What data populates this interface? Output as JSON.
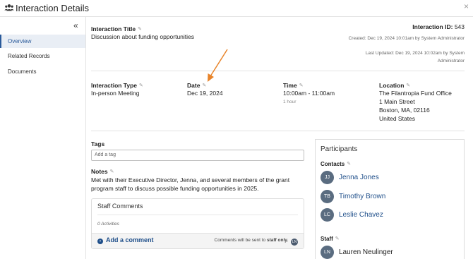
{
  "window": {
    "title": "Interaction Details",
    "close_label": "×"
  },
  "sidebar": {
    "collapse_label": "«",
    "items": [
      {
        "label": "Overview",
        "active": true
      },
      {
        "label": "Related Records",
        "active": false
      },
      {
        "label": "Documents",
        "active": false
      }
    ]
  },
  "interaction": {
    "title_label": "Interaction Title",
    "title_value": "Discussion about funding opportunities",
    "id_label": "Interaction ID:",
    "id_value": "543",
    "created": "Created: Dec 19, 2024 10:01am by System Administrator",
    "updated": "Last Updated: Dec 19, 2024 10:02am by System Administrator",
    "type_label": "Interaction Type",
    "type_value": "In-person Meeting",
    "date_label": "Date",
    "date_value": "Dec 19, 2024",
    "time_label": "Time",
    "time_value": "10:00am - 11:00am",
    "duration": "1 hour",
    "location_label": "Location",
    "location_lines": [
      "The Filantropia Fund Office",
      "1 Main Street",
      "Boston, MA, 02116",
      "United States"
    ]
  },
  "tags": {
    "label": "Tags",
    "placeholder": "Add a tag"
  },
  "notes": {
    "label": "Notes",
    "text": "Met with their Executive Director, Jenna, and several members of the grant program staff to discuss possible funding opportunities in 2025."
  },
  "comments": {
    "title": "Staff Comments",
    "count": "0 Activities",
    "add_label": "Add a comment",
    "note_prefix": "Comments will be sent to ",
    "note_bold": "staff only.",
    "note_initials": "LN"
  },
  "participants": {
    "title": "Participants",
    "contacts_label": "Contacts",
    "contacts": [
      {
        "initials": "JJ",
        "name": "Jenna Jones"
      },
      {
        "initials": "TB",
        "name": "Timothy Brown"
      },
      {
        "initials": "LC",
        "name": "Leslie Chavez"
      }
    ],
    "staff_label": "Staff",
    "staff": [
      {
        "initials": "LN",
        "name": "Lauren Neulinger"
      }
    ]
  },
  "colors": {
    "accent": "#1f4f8a",
    "annotation_arrow": "#e8842a",
    "avatar": "#5a6c80"
  }
}
